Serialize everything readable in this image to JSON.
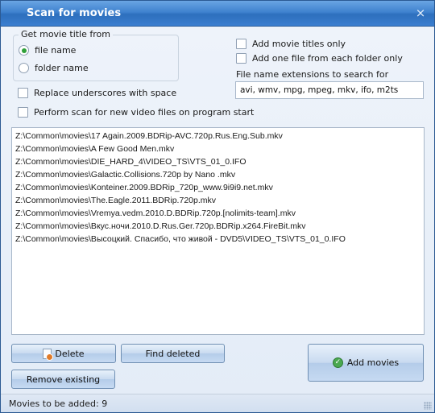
{
  "window": {
    "title": "Scan for movies",
    "close_glyph": "×"
  },
  "get_title": {
    "legend": "Get movie title from",
    "options": [
      {
        "label": "file name",
        "checked": true
      },
      {
        "label": "folder name",
        "checked": false
      }
    ]
  },
  "options": {
    "replace_underscores": "Replace underscores with space",
    "scan_on_start": "Perform scan for new video files on program start",
    "add_titles_only": "Add movie titles only",
    "one_file_per_folder": "Add one file from each folder only"
  },
  "extensions": {
    "label": "File name extensions to search for",
    "value": "avi, wmv, mpg, mpeg, mkv, ifo, m2ts"
  },
  "files": [
    "Z:\\Common\\movies\\17 Again.2009.BDRip-AVC.720p.Rus.Eng.Sub.mkv",
    "Z:\\Common\\movies\\A Few Good Men.mkv",
    "Z:\\Common\\movies\\DIE_HARD_4\\VIDEO_TS\\VTS_01_0.IFO",
    "Z:\\Common\\movies\\Galactic.Collisions.720p by Nano .mkv",
    "Z:\\Common\\movies\\Konteiner.2009.BDRip_720p_www.9i9i9.net.mkv",
    "Z:\\Common\\movies\\The.Eagle.2011.BDRip.720p.mkv",
    "Z:\\Common\\movies\\Vremya.vedm.2010.D.BDRip.720p.[nolimits-team].mkv",
    "Z:\\Common\\movies\\Вкус.ночи.2010.D.Rus.Ger.720p.BDRip.x264.FireBit.mkv",
    "Z:\\Common\\movies\\Высоцкий. Спасибо, что живой - DVD5\\VIDEO_TS\\VTS_01_0.IFO"
  ],
  "buttons": {
    "delete": "Delete",
    "find_deleted": "Find deleted",
    "remove_existing": "Remove existing",
    "add_movies": "Add movies"
  },
  "status": {
    "text": "Movies to be added: 9"
  },
  "icons": {
    "delete": "document-delete-icon",
    "add": "ok-check-icon"
  },
  "colors": {
    "titlebar": "#3f82cf",
    "radio_selected": "#2fa03a",
    "ok_icon": "#4aa84f"
  }
}
